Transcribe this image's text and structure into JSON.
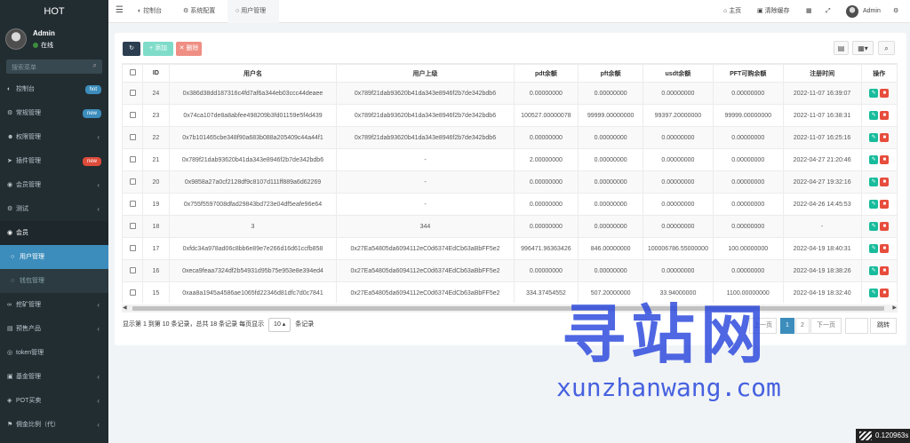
{
  "app": {
    "title": "HOT"
  },
  "user": {
    "name": "Admin",
    "status": "在线"
  },
  "sidebar": {
    "search_placeholder": "搜索菜单",
    "items": [
      {
        "label": "控制台",
        "badge": "hot",
        "badge_color": "#3c8dbc",
        "icon": "dashboard-icon"
      },
      {
        "label": "常规管理",
        "badge": "new",
        "badge_color": "#3c8dbc",
        "icon": "cogs-icon"
      },
      {
        "label": "权限管理",
        "icon": "group-icon"
      },
      {
        "label": "插件管理",
        "badge": "new",
        "badge_color": "#dd4b39",
        "icon": "rocket-icon"
      },
      {
        "label": "会员管理",
        "icon": "user-circle-icon"
      },
      {
        "label": "测试",
        "icon": "gear-icon"
      },
      {
        "label": "会员",
        "icon": "user-circle-icon"
      },
      {
        "label": "用户管理",
        "icon": "circle-icon"
      },
      {
        "label": "钱包管理",
        "icon": "circle-icon"
      },
      {
        "label": "挖矿管理",
        "icon": "link-icon"
      },
      {
        "label": "预售产品",
        "icon": "product-icon"
      },
      {
        "label": "token管理",
        "icon": "token-icon"
      },
      {
        "label": "基金管理",
        "icon": "fund-icon"
      },
      {
        "label": "POT买卖",
        "icon": "trade-icon"
      },
      {
        "label": "佣金比例（代）",
        "icon": "commission-icon"
      }
    ]
  },
  "topbar": {
    "tabs": [
      {
        "label": "控制台",
        "icon": "dashboard-icon"
      },
      {
        "label": "系统配置",
        "icon": "gear-icon"
      },
      {
        "label": "用户管理",
        "icon": "circle-icon"
      }
    ],
    "home": "主页",
    "clear_cache": "清除缓存",
    "admin": "Admin"
  },
  "toolbar": {
    "add": "添加",
    "delete": "删除"
  },
  "table": {
    "columns": [
      "ID",
      "用户名",
      "用户上级",
      "pdt余额",
      "pft余额",
      "usdt余额",
      "PFT可购余额",
      "注册时间",
      "操作"
    ],
    "rows": [
      [
        "24",
        "0x386d38dd187316c4fd7af6a344eb03ccc44deaee",
        "0x789f21dab93620b41da343e8946f2b7de342bdb6",
        "0.00000000",
        "0.00000000",
        "0.00000000",
        "0.00000000",
        "2022-11-07 16:39:07"
      ],
      [
        "23",
        "0x74ca107de8a8abfee498209b3fd01159e5f4d439",
        "0x789f21dab93620b41da343e8946f2b7de342bdb6",
        "100527.00000078",
        "99999.00000000",
        "99397.20000000",
        "99999.00000000",
        "2022-11-07 16:38:31"
      ],
      [
        "22",
        "0x7b101465cbe348f90a683b088a205409c44a44f1",
        "0x789f21dab93620b41da343e8946f2b7de342bdb6",
        "0.00000000",
        "0.00000000",
        "0.00000000",
        "0.00000000",
        "2022-11-07 16:25:16"
      ],
      [
        "21",
        "0x789f21dab93620b41da343e8946f2b7de342bdb6",
        "-",
        "2.00000000",
        "0.00000000",
        "0.00000000",
        "0.00000000",
        "2022-04-27 21:20:46"
      ],
      [
        "20",
        "0x9858a27a0cf2128df9c8107d111ff889a6d62269",
        "-",
        "0.00000000",
        "0.00000000",
        "0.00000000",
        "0.00000000",
        "2022-04-27 19:32:16"
      ],
      [
        "19",
        "0x755f5597008dfad29843bd723e04df5eafe96e64",
        "-",
        "0.00000000",
        "0.00000000",
        "0.00000000",
        "0.00000000",
        "2022-04-26 14:45:53"
      ],
      [
        "18",
        "3",
        "344",
        "0.00000000",
        "0.00000000",
        "0.00000000",
        "0.00000000",
        "-"
      ],
      [
        "17",
        "0xfdc34a978ad06c8bb6e89e7e266d16d61ccfb858",
        "0x27Ea54805da6094112eC0d6374EdCb63aBbFF5e2",
        "996471.96363426",
        "846.00000000",
        "100006786.55000000",
        "100.00000000",
        "2022-04-19 18:40:31"
      ],
      [
        "16",
        "0xeca9feaa7324df2b54931d95b75e953e8e394ed4",
        "0x27Ea54805da6094112eC0d6374EdCb63aBbFF5e2",
        "0.00000000",
        "0.00000000",
        "0.00000000",
        "0.00000000",
        "2022-04-19 18:38:26"
      ],
      [
        "15",
        "0xaa8a1945a4586ae1065fd22346d81dfc7d0c7841",
        "0x27Ea54805da6094112eC0d6374EdCb63aBbFF5e2",
        "334.37454552",
        "507.20000000",
        "33.94000000",
        "1100.00000000",
        "2022-04-19 18:32:40"
      ]
    ]
  },
  "pagination": {
    "info_prefix": "显示第 1 到第 10 条记录，总共 18 条记录 每页显示",
    "page_size": "10",
    "info_suffix": "条记录",
    "prev": "上一页",
    "pages": [
      "1",
      "2"
    ],
    "next": "下一页",
    "jump": "跳转"
  },
  "watermark": {
    "text": "寻站网",
    "url": "xunzhanwang.com"
  },
  "timer": "0.120963s",
  "colors": {
    "sidebar_bg": "#222d32",
    "accent": "#3c8dbc",
    "add_button": "#18bc9c",
    "delete_button": "#e74c3c",
    "refresh_button": "#2c3e50"
  }
}
